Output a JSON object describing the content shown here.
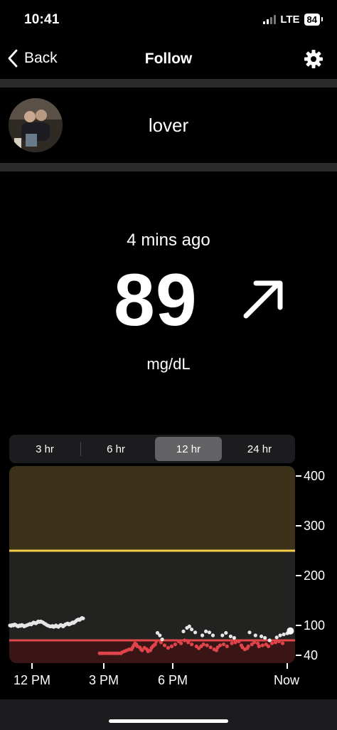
{
  "status_bar": {
    "time": "10:41",
    "network": "LTE",
    "battery": "84"
  },
  "nav": {
    "back_label": "Back",
    "title": "Follow",
    "settings_icon": "gear-icon"
  },
  "profile": {
    "name": "lover"
  },
  "reading": {
    "time_ago": "4 mins ago",
    "value": "89",
    "unit": "mg/dL",
    "trend": "rising"
  },
  "range_selector": {
    "options": [
      "3 hr",
      "6 hr",
      "12 hr",
      "24 hr"
    ],
    "selected": "12 hr"
  },
  "chart_data": {
    "type": "scatter",
    "y_ticks": [
      "400",
      "300",
      "200",
      "100",
      "40"
    ],
    "x_ticks": [
      "12 PM",
      "3 PM",
      "6 PM",
      "Now"
    ],
    "high_line": 250,
    "low_line": 70,
    "colors": {
      "high_zone": "#3b3219",
      "target_zone": "#222220",
      "low_zone": "#3a1516",
      "high_line": "#f5cc4a",
      "low_line": "#e2474b",
      "in_range_point": "#e6e6e6",
      "low_point": "#e0444a"
    },
    "white_series": [
      [
        0.0,
        100
      ],
      [
        0.05,
        99
      ],
      [
        0.1,
        101
      ],
      [
        0.15,
        100
      ],
      [
        0.2,
        102
      ],
      [
        0.25,
        101
      ],
      [
        0.3,
        99
      ],
      [
        0.35,
        98
      ],
      [
        0.4,
        100
      ],
      [
        0.45,
        99
      ],
      [
        0.5,
        101
      ],
      [
        0.55,
        100
      ],
      [
        0.6,
        98
      ],
      [
        0.65,
        99
      ],
      [
        0.7,
        100
      ],
      [
        0.75,
        101
      ],
      [
        0.8,
        102
      ],
      [
        0.85,
        103
      ],
      [
        0.9,
        102
      ],
      [
        0.95,
        104
      ],
      [
        1.0,
        106
      ],
      [
        1.05,
        105
      ],
      [
        1.1,
        104
      ],
      [
        1.15,
        106
      ],
      [
        1.2,
        108
      ],
      [
        1.25,
        107
      ],
      [
        1.3,
        108
      ],
      [
        1.35,
        107
      ],
      [
        1.4,
        106
      ],
      [
        1.45,
        104
      ],
      [
        1.5,
        103
      ],
      [
        1.55,
        101
      ],
      [
        1.6,
        100
      ],
      [
        1.65,
        99
      ],
      [
        1.7,
        98
      ],
      [
        1.75,
        98
      ],
      [
        1.8,
        99
      ],
      [
        1.85,
        97
      ],
      [
        1.9,
        98
      ],
      [
        1.95,
        100
      ],
      [
        2.0,
        98
      ],
      [
        2.05,
        97
      ],
      [
        2.1,
        99
      ],
      [
        2.15,
        101
      ],
      [
        2.2,
        100
      ],
      [
        2.25,
        98
      ],
      [
        2.3,
        100
      ],
      [
        2.35,
        102
      ],
      [
        2.4,
        103
      ],
      [
        2.45,
        104
      ],
      [
        2.5,
        102
      ],
      [
        2.55,
        103
      ],
      [
        2.6,
        104
      ],
      [
        2.65,
        106
      ],
      [
        2.7,
        105
      ],
      [
        2.75,
        107
      ],
      [
        2.8,
        109
      ],
      [
        2.85,
        111
      ],
      [
        2.9,
        112
      ],
      [
        2.95,
        111
      ],
      [
        3.0,
        113
      ],
      [
        3.05,
        115
      ],
      [
        3.1,
        114
      ],
      [
        6.25,
        85
      ],
      [
        6.35,
        80
      ],
      [
        6.45,
        72
      ],
      [
        7.35,
        88
      ],
      [
        7.5,
        95
      ],
      [
        7.6,
        98
      ],
      [
        7.7,
        92
      ],
      [
        7.85,
        86
      ],
      [
        8.15,
        80
      ],
      [
        8.3,
        88
      ],
      [
        8.45,
        86
      ],
      [
        8.6,
        80
      ],
      [
        9.0,
        80
      ],
      [
        9.15,
        85
      ],
      [
        9.35,
        78
      ],
      [
        9.5,
        75
      ],
      [
        10.15,
        86
      ],
      [
        10.4,
        80
      ],
      [
        10.65,
        78
      ],
      [
        10.8,
        75
      ],
      [
        11.0,
        70
      ],
      [
        11.3,
        76
      ],
      [
        11.45,
        80
      ],
      [
        11.6,
        82
      ],
      [
        11.75,
        84
      ],
      [
        11.88,
        89
      ]
    ],
    "red_series": [
      [
        3.8,
        44
      ],
      [
        3.9,
        44
      ],
      [
        4.0,
        44
      ],
      [
        4.1,
        44
      ],
      [
        4.2,
        44
      ],
      [
        4.3,
        44
      ],
      [
        4.4,
        44
      ],
      [
        4.5,
        44
      ],
      [
        4.6,
        44
      ],
      [
        4.7,
        44
      ],
      [
        4.75,
        46
      ],
      [
        4.85,
        48
      ],
      [
        4.95,
        50
      ],
      [
        5.05,
        52
      ],
      [
        5.15,
        52
      ],
      [
        5.2,
        56
      ],
      [
        5.25,
        60
      ],
      [
        5.3,
        64
      ],
      [
        5.35,
        62
      ],
      [
        5.4,
        58
      ],
      [
        5.5,
        56
      ],
      [
        5.55,
        52
      ],
      [
        5.6,
        50
      ],
      [
        5.7,
        55
      ],
      [
        5.8,
        52
      ],
      [
        5.85,
        48
      ],
      [
        5.95,
        50
      ],
      [
        6.0,
        55
      ],
      [
        6.05,
        58
      ],
      [
        6.1,
        60
      ],
      [
        6.15,
        62
      ],
      [
        6.2,
        68
      ],
      [
        6.4,
        66
      ],
      [
        6.55,
        60
      ],
      [
        6.7,
        55
      ],
      [
        6.85,
        58
      ],
      [
        7.0,
        62
      ],
      [
        7.15,
        68
      ],
      [
        7.25,
        64
      ],
      [
        7.4,
        70
      ],
      [
        7.55,
        66
      ],
      [
        7.7,
        62
      ],
      [
        7.9,
        58
      ],
      [
        8.0,
        54
      ],
      [
        8.1,
        58
      ],
      [
        8.2,
        62
      ],
      [
        8.35,
        60
      ],
      [
        8.5,
        56
      ],
      [
        8.65,
        52
      ],
      [
        8.75,
        50
      ],
      [
        8.8,
        56
      ],
      [
        8.9,
        60
      ],
      [
        9.05,
        62
      ],
      [
        9.2,
        58
      ],
      [
        9.4,
        64
      ],
      [
        9.55,
        66
      ],
      [
        9.7,
        68
      ],
      [
        9.8,
        60
      ],
      [
        9.85,
        56
      ],
      [
        9.95,
        52
      ],
      [
        10.05,
        54
      ],
      [
        10.1,
        58
      ],
      [
        10.25,
        62
      ],
      [
        10.35,
        66
      ],
      [
        10.5,
        64
      ],
      [
        10.55,
        58
      ],
      [
        10.7,
        60
      ],
      [
        10.85,
        62
      ],
      [
        10.95,
        58
      ],
      [
        11.1,
        64
      ],
      [
        11.25,
        66
      ],
      [
        11.4,
        68
      ],
      [
        11.55,
        64
      ]
    ]
  }
}
